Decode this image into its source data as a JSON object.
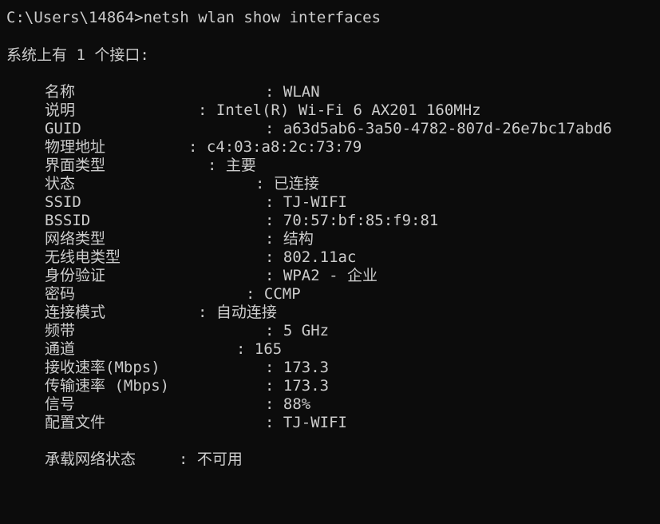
{
  "terminal": {
    "prompt": "C:\\Users\\14864>",
    "command": "netsh wlan show interfaces",
    "summary": "系统上有 1 个接口:",
    "rows": [
      {
        "key": "名称",
        "value": "WLAN"
      },
      {
        "key": "说明",
        "value": "Intel(R) Wi-Fi 6 AX201 160MHz"
      },
      {
        "key": "GUID",
        "value": "a63d5ab6-3a50-4782-807d-26e7bc17abd6"
      },
      {
        "key": "物理地址",
        "value": "c4:03:a8:2c:73:79"
      },
      {
        "key": "界面类型",
        "value": "主要"
      },
      {
        "key": "状态",
        "value": "已连接"
      },
      {
        "key": "SSID",
        "value": "TJ-WIFI"
      },
      {
        "key": "BSSID",
        "value": "70:57:bf:85:f9:81"
      },
      {
        "key": "网络类型",
        "value": "结构"
      },
      {
        "key": "无线电类型",
        "value": "802.11ac"
      },
      {
        "key": "身份验证",
        "value": "WPA2 - 企业"
      },
      {
        "key": "密码",
        "value": "CCMP"
      },
      {
        "key": "连接模式",
        "value": "自动连接"
      },
      {
        "key": "频带",
        "value": "5 GHz"
      },
      {
        "key": "通道",
        "value": "165"
      },
      {
        "key": "接收速率(Mbps)",
        "value": "173.3"
      },
      {
        "key": "传输速率 (Mbps)",
        "value": "173.3"
      },
      {
        "key": "信号",
        "value": "88%"
      },
      {
        "key": "配置文件",
        "value": "TJ-WIFI"
      }
    ],
    "hosted": {
      "key": "承载网络状态",
      "value": "不可用"
    }
  }
}
